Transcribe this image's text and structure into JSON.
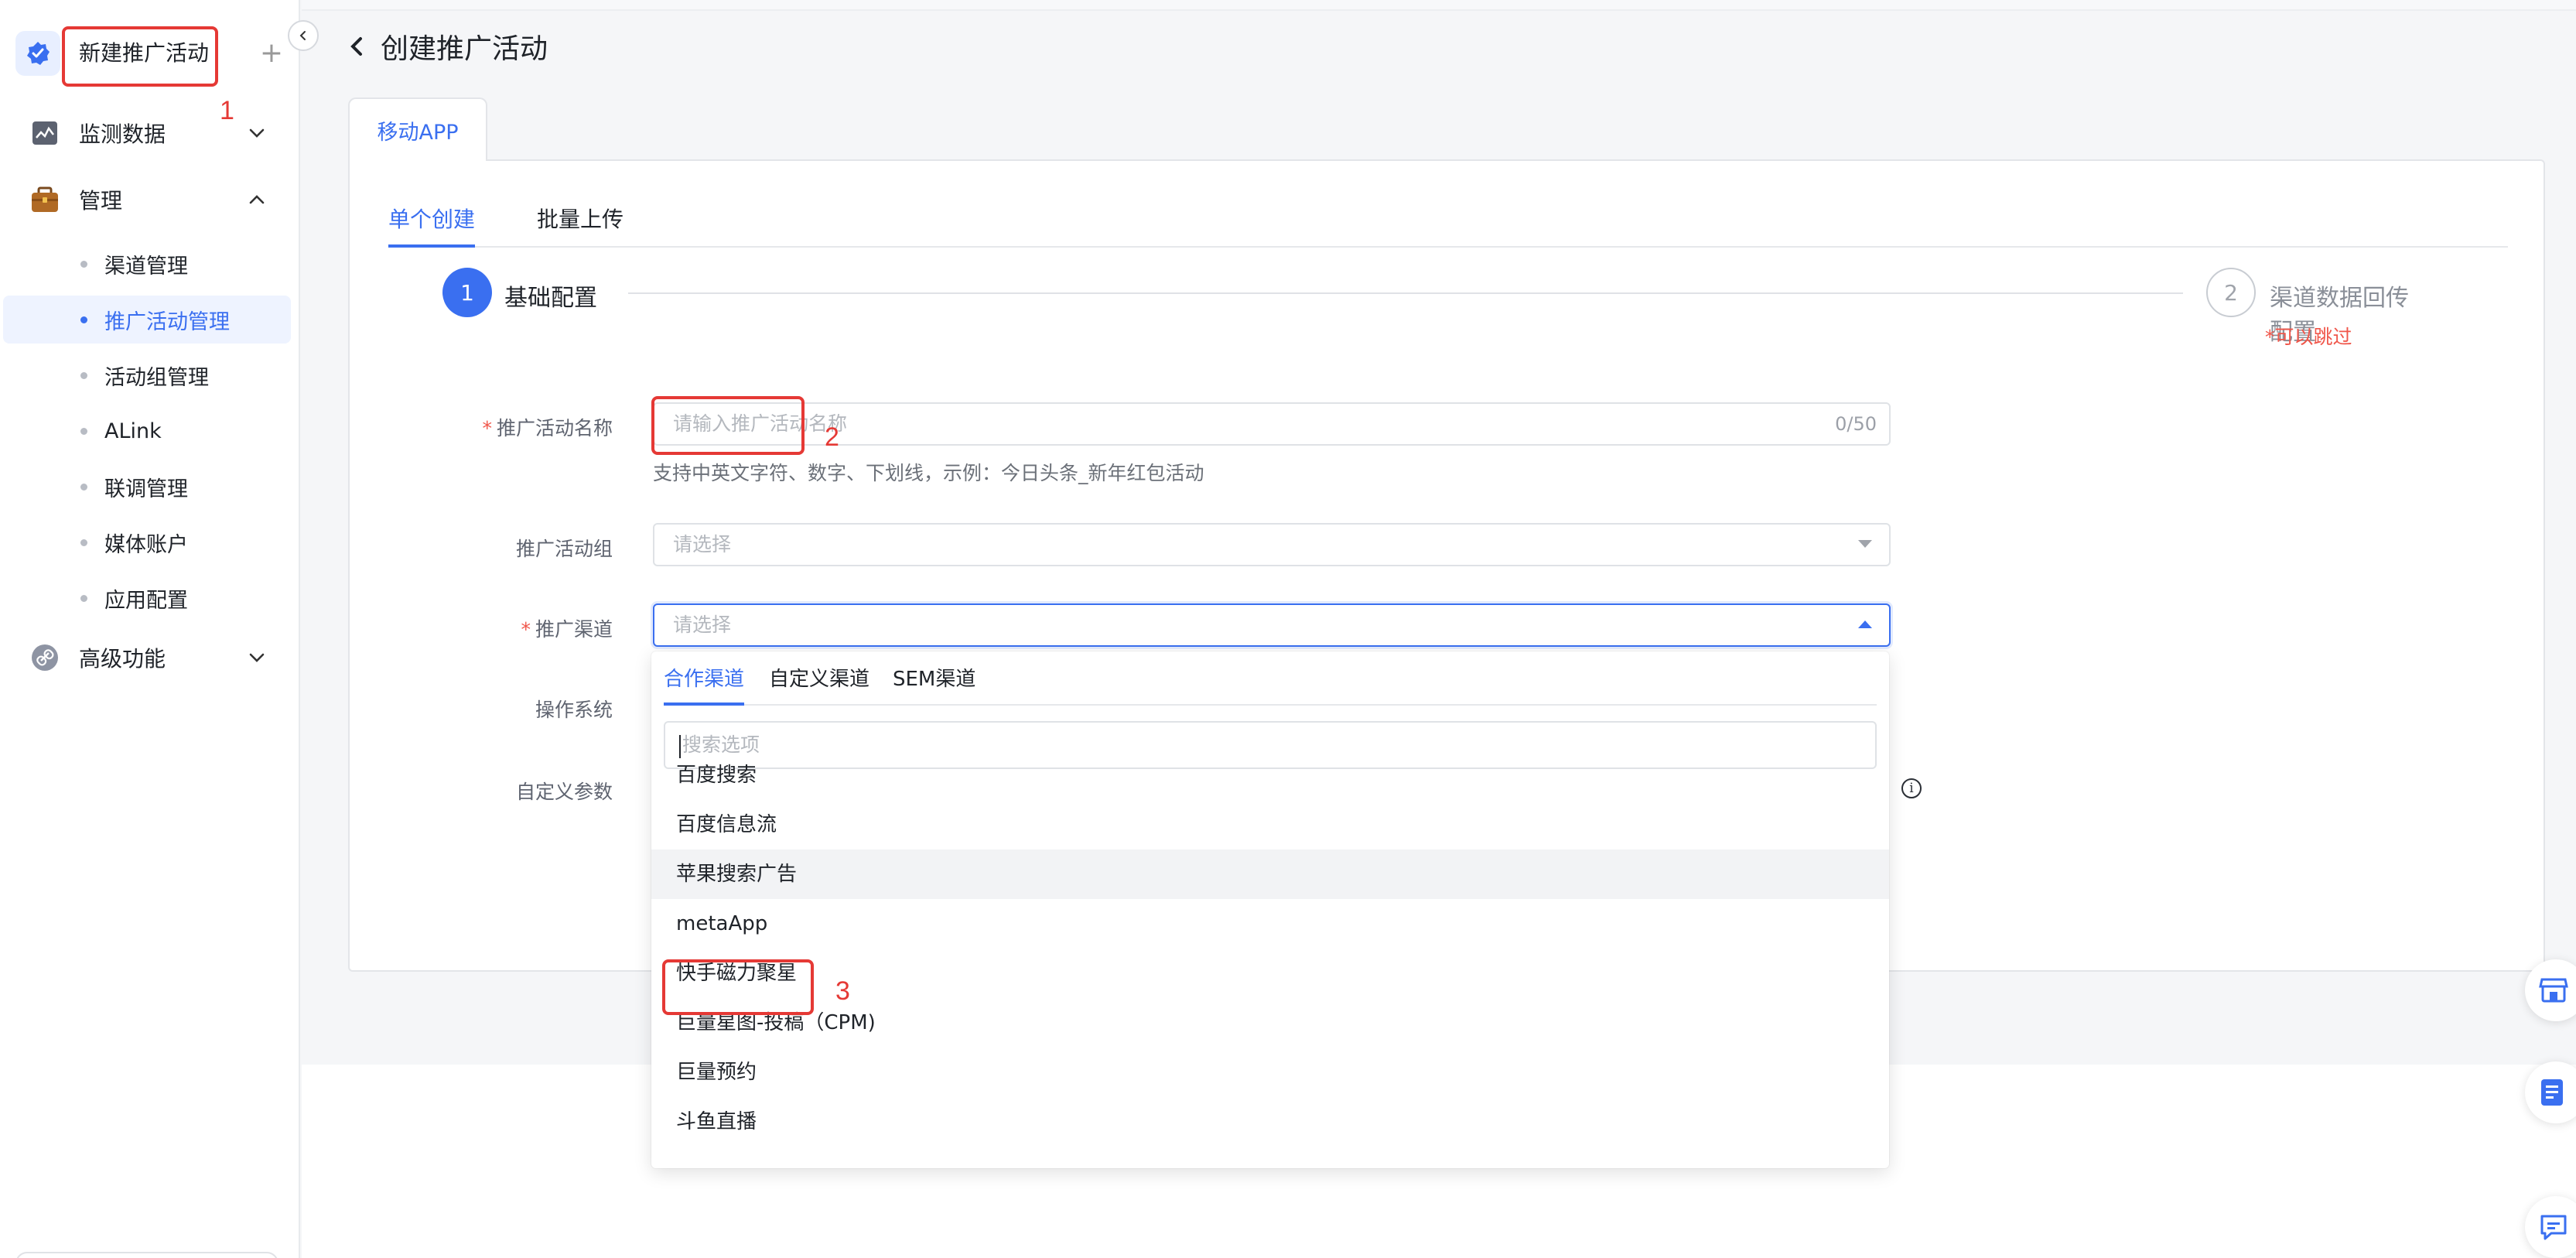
{
  "sidebar": {
    "new_campaign_label": "新建推广活动",
    "plus_symbol": "+",
    "groups": [
      {
        "label": "监测数据",
        "icon": "chart-line-icon",
        "expanded": false
      },
      {
        "label": "管理",
        "icon": "briefcase-icon",
        "expanded": true
      },
      {
        "label": "高级功能",
        "icon": "link-icon",
        "expanded": false
      }
    ],
    "items": [
      {
        "label": "渠道管理",
        "active": false
      },
      {
        "label": "推广活动管理",
        "active": true
      },
      {
        "label": "活动组管理",
        "active": false
      },
      {
        "label": "ALink",
        "active": false
      },
      {
        "label": "联调管理",
        "active": false
      },
      {
        "label": "媒体账户",
        "active": false
      },
      {
        "label": "应用配置",
        "active": false
      }
    ]
  },
  "header": {
    "title": "创建推广活动"
  },
  "platform_tab": "移动APP",
  "sub_tabs": [
    "单个创建",
    "批量上传"
  ],
  "steps": [
    {
      "number": "1",
      "label": "基础配置",
      "active": true
    },
    {
      "number": "2",
      "label": "渠道数据回传配置",
      "active": false,
      "note": "*可以跳过"
    }
  ],
  "form": {
    "required_mark": "*",
    "campaign_name": {
      "label": "推广活动名称",
      "placeholder": "请输入推广活动名称",
      "counter": "0/50",
      "help": "支持中英文字符、数字、下划线，示例：今日头条_新年红包活动"
    },
    "campaign_group": {
      "label": "推广活动组",
      "placeholder": "请选择"
    },
    "channel": {
      "label": "推广渠道",
      "placeholder": "请选择"
    },
    "os_label": "操作系统",
    "custom_params_label": "自定义参数",
    "info_glyph": "i"
  },
  "dropdown": {
    "tabs": [
      "合作渠道",
      "自定义渠道",
      "SEM渠道"
    ],
    "search_placeholder": "搜索选项",
    "options": [
      "百度搜索",
      "百度信息流",
      "苹果搜索广告",
      "metaApp",
      "快手磁力聚星",
      "巨量星图-投稿（CPM)",
      "巨量预约",
      "斗鱼直播"
    ],
    "hovered_index": 2
  },
  "annotations": [
    "1",
    "2",
    "3"
  ],
  "colors": {
    "accent": "#3a6ff0",
    "required": "#f0564a",
    "annotation": "#e53935"
  }
}
